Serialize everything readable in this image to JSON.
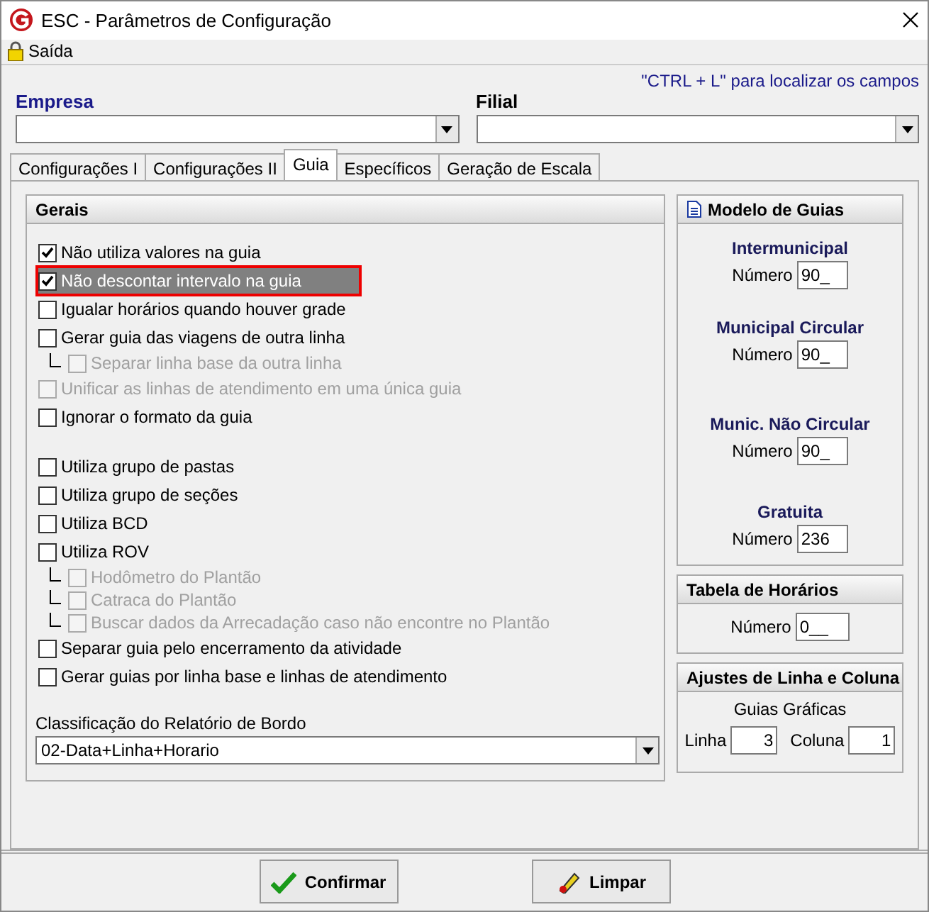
{
  "window": {
    "title": "ESC - Parâmetros de Configuração"
  },
  "menu": [
    {
      "label": "Saída"
    }
  ],
  "header": {
    "empresa_label": "Empresa",
    "filial_label": "Filial",
    "hint": "\"CTRL + L\" para localizar os campos"
  },
  "tabs": [
    {
      "label": "Configurações I",
      "selected": false
    },
    {
      "label": "Configurações II",
      "selected": false
    },
    {
      "label": "Guia",
      "selected": true
    },
    {
      "label": "Específicos",
      "selected": false
    },
    {
      "label": "Geração de Escala",
      "selected": false
    }
  ],
  "gerais": {
    "title": "Gerais",
    "groups": [
      {
        "items": [
          {
            "label": "Não utiliza valores na guia",
            "checked": true,
            "disabled": false,
            "highlighted": false
          },
          {
            "label": "Não descontar intervalo na guia",
            "checked": true,
            "disabled": false,
            "highlighted": true
          },
          {
            "label": "Igualar horários quando houver grade",
            "checked": false,
            "disabled": false,
            "highlighted": false
          },
          {
            "label": "Gerar guia das viagens de outra linha",
            "checked": false,
            "disabled": false,
            "highlighted": false,
            "children": [
              {
                "label": "Separar linha base da outra linha",
                "checked": false,
                "disabled": true,
                "highlighted": false
              }
            ]
          },
          {
            "label": "Unificar as linhas de atendimento em uma única guia",
            "checked": false,
            "disabled": true,
            "highlighted": false
          },
          {
            "label": "Ignorar o formato da guia",
            "checked": false,
            "disabled": false,
            "highlighted": false
          }
        ]
      },
      {
        "items": [
          {
            "label": "Utiliza grupo de pastas",
            "checked": false,
            "disabled": false,
            "highlighted": false
          },
          {
            "label": "Utiliza grupo de seções",
            "checked": false,
            "disabled": false,
            "highlighted": false
          },
          {
            "label": "Utiliza BCD",
            "checked": false,
            "disabled": false,
            "highlighted": false
          },
          {
            "label": "Utiliza ROV",
            "checked": false,
            "disabled": false,
            "highlighted": false,
            "children": [
              {
                "label": "Hodômetro do Plantão",
                "checked": false,
                "disabled": true,
                "highlighted": false
              },
              {
                "label": "Catraca do Plantão",
                "checked": false,
                "disabled": true,
                "highlighted": false
              },
              {
                "label": "Buscar dados da Arrecadação caso não encontre no Plantão",
                "checked": false,
                "disabled": true,
                "highlighted": false
              }
            ]
          },
          {
            "label": "Separar guia pelo encerramento da atividade",
            "checked": false,
            "disabled": false,
            "highlighted": false
          },
          {
            "label": "Gerar guias por linha base e linhas de atendimento",
            "checked": false,
            "disabled": false,
            "highlighted": false
          }
        ]
      }
    ],
    "select_label": "Classificação do Relatório de Bordo",
    "select_value": "02-Data+Linha+Horario"
  },
  "modelo": {
    "title": "Modelo de Guias",
    "entries": [
      {
        "heading": "Intermunicipal",
        "label": "Número",
        "value": "90_"
      },
      {
        "heading": "Municipal Circular",
        "label": "Número",
        "value": "90_"
      },
      {
        "heading": "Munic. Não Circular",
        "label": "Número",
        "value": "90_"
      },
      {
        "heading": "Gratuita",
        "label": "Número",
        "value": "236"
      }
    ]
  },
  "tabela": {
    "title": "Tabela de Horários",
    "label": "Número",
    "value": "0__"
  },
  "ajustes": {
    "title": "Ajustes de Linha e Coluna",
    "subtitle": "Guias Gráficas",
    "linha_label": "Linha",
    "linha_value": "3",
    "coluna_label": "Coluna",
    "coluna_value": "1"
  },
  "buttons": [
    {
      "kind": "confirm",
      "label": "Confirmar"
    },
    {
      "kind": "clear",
      "label": "Limpar"
    }
  ]
}
